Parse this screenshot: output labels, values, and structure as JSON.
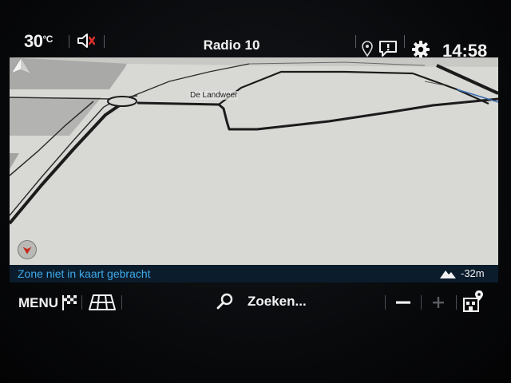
{
  "status": {
    "temperature": "30",
    "temperature_unit": "°C",
    "station": "Radio 10",
    "clock": "14:58"
  },
  "map": {
    "road_label": "De Landweer"
  },
  "info": {
    "zone_text": "Zone niet in kaart gebracht",
    "elevation": "-32m"
  },
  "toolbar": {
    "menu_label": "MENU",
    "search_label": "Zoeken..."
  },
  "colors": {
    "map_ground": "#d7d7d4",
    "info_text": "#3fa9e8",
    "info_bg": "#0b1c2c",
    "compass_arrow": "#c62a1d"
  },
  "icons": [
    "mute-speaker-icon",
    "location-pin-icon",
    "message-icon",
    "gear-icon",
    "flag-icon",
    "map-grid-icon",
    "search-icon",
    "compass-icon",
    "vehicle-arrow-icon",
    "elevation-icon",
    "zoom-out-icon",
    "zoom-in-icon",
    "poi-icon"
  ]
}
